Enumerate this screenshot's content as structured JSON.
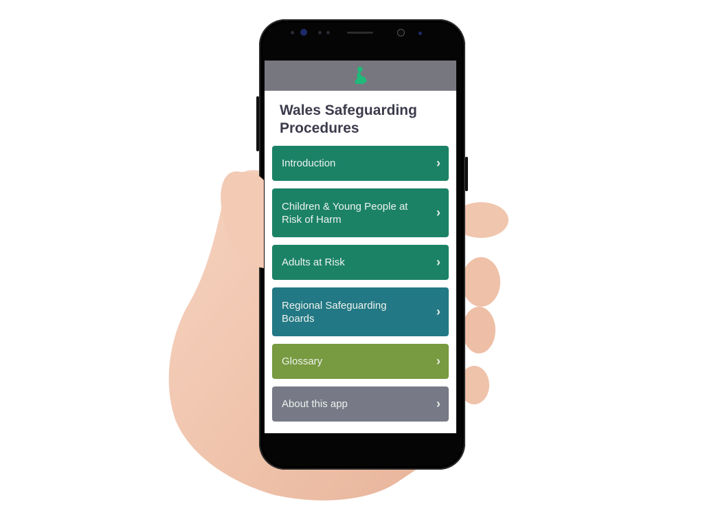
{
  "app": {
    "logo_icon": "wales-map-icon",
    "title": "Wales Safeguarding Procedures"
  },
  "menu": {
    "items": [
      {
        "label": "Introduction",
        "color": "#1b8266",
        "icon": "chevron-right-icon"
      },
      {
        "label": "Children & Young People at Risk of Harm",
        "color": "#1b8266",
        "icon": "chevron-right-icon"
      },
      {
        "label": "Adults at Risk",
        "color": "#1b8266",
        "icon": "chevron-right-icon"
      },
      {
        "label": "Regional Safeguarding Boards",
        "color": "#227884",
        "icon": "chevron-right-icon"
      },
      {
        "label": "Glossary",
        "color": "#789a40",
        "icon": "chevron-right-icon"
      },
      {
        "label": "About this app",
        "color": "#777a86",
        "icon": "chevron-right-icon"
      }
    ],
    "chevron": "›"
  },
  "colors": {
    "header_bar": "#77777f",
    "logo": "#1fba7a",
    "title_text": "#3b3b4c"
  }
}
